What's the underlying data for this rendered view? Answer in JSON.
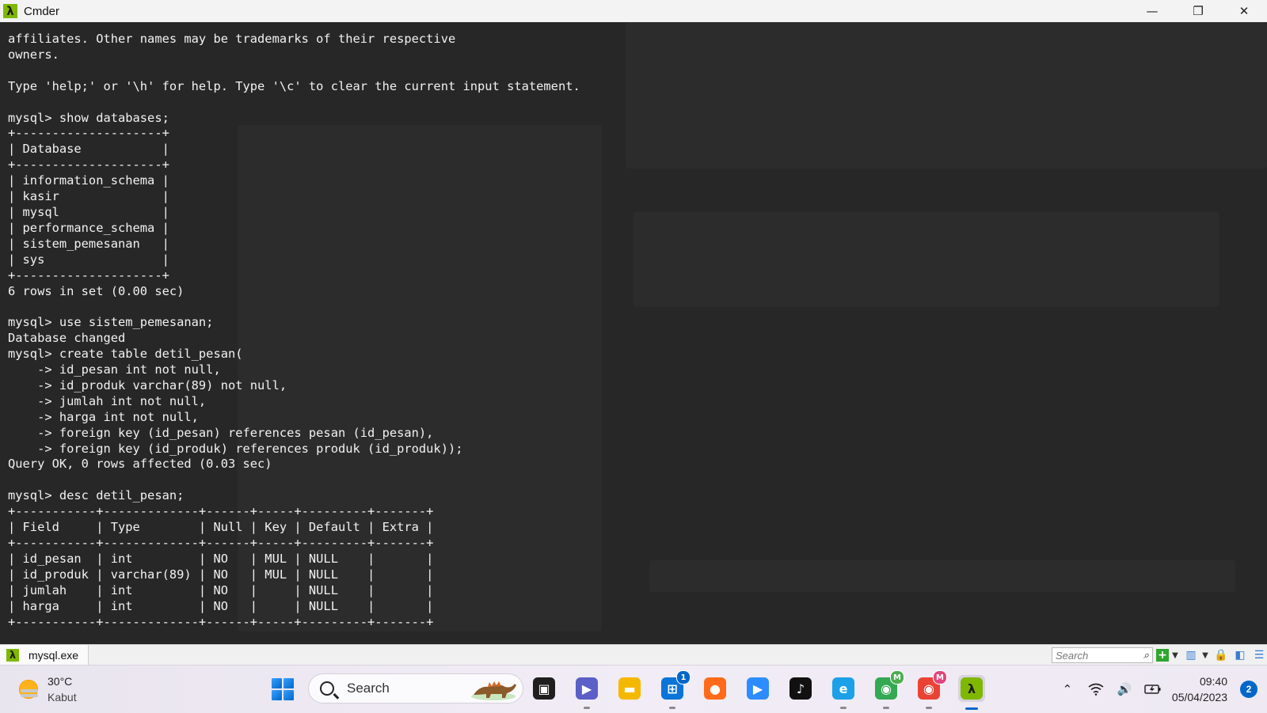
{
  "window": {
    "title": "Cmder",
    "app_icon": "λ",
    "controls": {
      "minimize": "—",
      "restore": "❐",
      "close": "✕"
    }
  },
  "terminal": {
    "lines": [
      "affiliates. Other names may be trademarks of their respective",
      "owners.",
      "",
      "Type 'help;' or '\\h' for help. Type '\\c' to clear the current input statement.",
      "",
      "mysql> show databases;",
      "+--------------------+",
      "| Database           |",
      "+--------------------+",
      "| information_schema |",
      "| kasir              |",
      "| mysql              |",
      "| performance_schema |",
      "| sistem_pemesanan   |",
      "| sys                |",
      "+--------------------+",
      "6 rows in set (0.00 sec)",
      "",
      "mysql> use sistem_pemesanan;",
      "Database changed",
      "mysql> create table detil_pesan(",
      "    -> id_pesan int not null,",
      "    -> id_produk varchar(89) not null,",
      "    -> jumlah int not null,",
      "    -> harga int not null,",
      "    -> foreign key (id_pesan) references pesan (id_pesan),",
      "    -> foreign key (id_produk) references produk (id_produk));",
      "Query OK, 0 rows affected (0.03 sec)",
      "",
      "mysql> desc detil_pesan;",
      "+-----------+-------------+------+-----+---------+-------+",
      "| Field     | Type        | Null | Key | Default | Extra |",
      "+-----------+-------------+------+-----+---------+-------+",
      "| id_pesan  | int         | NO   | MUL | NULL    |       |",
      "| id_produk | varchar(89) | NO   | MUL | NULL    |       |",
      "| jumlah    | int         | NO   |     | NULL    |       |",
      "| harga     | int         | NO   |     | NULL    |       |",
      "+-----------+-------------+------+-----+---------+-------+"
    ]
  },
  "tabbar": {
    "tab_icon": "λ",
    "tab_label": "mysql.exe",
    "search_placeholder": "Search"
  },
  "taskbar": {
    "weather": {
      "temp": "30°C",
      "condition": "Kabut"
    },
    "search_label": "Search",
    "apps": [
      {
        "name": "task-view",
        "color": "#1f1f1f",
        "glyph": "▣"
      },
      {
        "name": "teams",
        "color": "#5b5fc7",
        "glyph": "▶"
      },
      {
        "name": "file-explorer",
        "color": "#f5b800",
        "glyph": "▬"
      },
      {
        "name": "microsoft-store",
        "color": "#0a74d9",
        "glyph": "⊞",
        "badge": "1"
      },
      {
        "name": "firefox",
        "color": "#ff6b1a",
        "glyph": "●"
      },
      {
        "name": "zoom",
        "color": "#2d8cff",
        "glyph": "▶"
      },
      {
        "name": "tiktok",
        "color": "#111111",
        "glyph": "♪"
      },
      {
        "name": "edge",
        "color": "#1ca0e8",
        "glyph": "e"
      },
      {
        "name": "chrome-profile-m-green",
        "color": "#34a853",
        "glyph": "◉",
        "badge": "M"
      },
      {
        "name": "chrome-profile-m-pink",
        "color": "#ea4335",
        "glyph": "◉",
        "badge": "M"
      },
      {
        "name": "cmder",
        "color": "#7fb800",
        "glyph": "λ"
      }
    ],
    "clock": {
      "time": "09:40",
      "date": "05/04/2023"
    },
    "notifications": "2",
    "tray_icons": [
      "chevron-up-icon",
      "wifi-icon",
      "volume-icon",
      "battery-icon"
    ]
  },
  "colors": {
    "terminal_bg": "#272727",
    "terminal_fg": "#f2f2f2",
    "cmder_green": "#7fb800",
    "accent": "#0067c8"
  }
}
